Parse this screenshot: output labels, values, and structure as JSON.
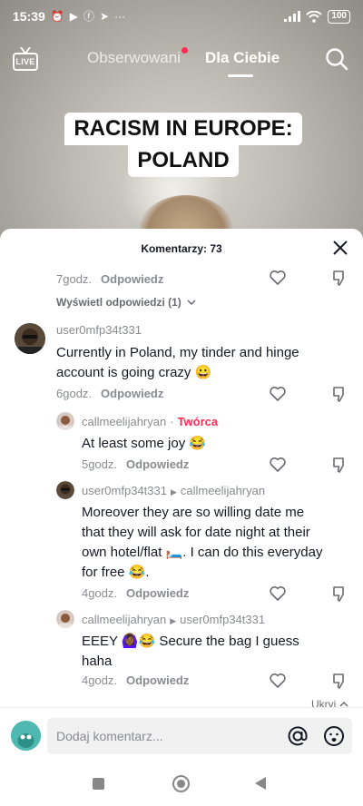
{
  "status_bar": {
    "time": "15:39",
    "battery": "100"
  },
  "top_nav": {
    "live_label": "LIVE",
    "following_tab": "Obserwowani",
    "for_you_tab": "Dla Ciebie"
  },
  "video": {
    "overlay_line1": "RACISM IN EUROPE:",
    "overlay_line2": "POLAND"
  },
  "comments_sheet": {
    "title": "Komentarzy: 73",
    "top_comment": {
      "time": "7godz.",
      "reply_label": "Odpowiedz",
      "view_replies": "Wyświetl odpowiedzi (1)"
    },
    "comments": [
      {
        "username": "user0mfp34t331",
        "text": "Currently in Poland, my tinder and hinge account is going crazy 😀",
        "time": "6godz.",
        "reply_label": "Odpowiedz"
      }
    ],
    "replies": [
      {
        "username": "callmeelijahryan",
        "badge": "Twórca",
        "text": "At least some joy 😂",
        "time": "5godz.",
        "reply_label": "Odpowiedz"
      },
      {
        "username": "user0mfp34t331",
        "reply_to": "callmeelijahryan",
        "text": "Moreover they are so willing date me that they will ask for date night at their own hotel/flat 🛏️. I can do this everyday for free 😂.",
        "time": "4godz.",
        "reply_label": "Odpowiedz"
      },
      {
        "username": "callmeelijahryan",
        "reply_to": "user0mfp34t331",
        "text": "EEEY 🙆🏾‍♀️😂 Secure the bag I guess haha",
        "time": "4godz.",
        "reply_label": "Odpowiedz"
      }
    ],
    "hide_label": "Ukryj"
  },
  "input_bar": {
    "placeholder": "Dodaj komentarz..."
  },
  "colors": {
    "accent": "#fe2c55",
    "muted_text": "#8a8b91",
    "input_bg": "#f1f1f2"
  }
}
